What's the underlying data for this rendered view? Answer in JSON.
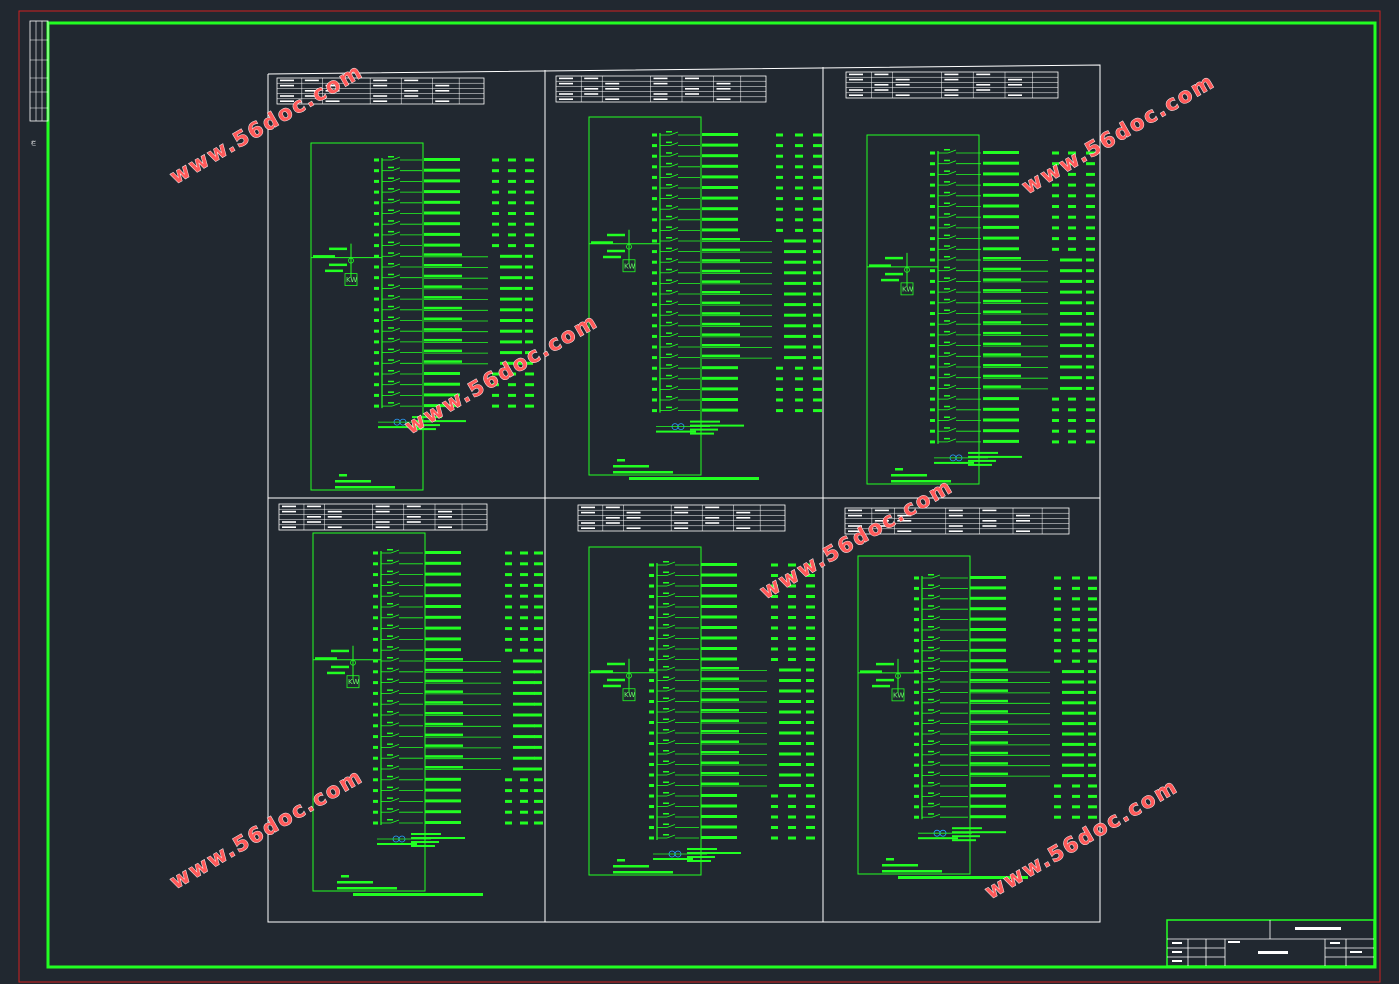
{
  "drawing": {
    "colors": {
      "background": "#212830",
      "outer_border": "#d02020",
      "inner_border": "#22ff22",
      "grid_lines": "#ffffff",
      "wire": "#22ff22",
      "watermark": "#ff5a5a",
      "dim_text": "#6cff6c"
    },
    "side_label": "栏",
    "watermark_text": "www.56doc.com",
    "meter_label": "KW",
    "panels": [
      {
        "id": "p1",
        "circuits": 24
      },
      {
        "id": "p2",
        "circuits": 27
      },
      {
        "id": "p3",
        "circuits": 28
      },
      {
        "id": "p4",
        "circuits": 26
      },
      {
        "id": "p5",
        "circuits": 27
      },
      {
        "id": "p6",
        "circuits": 24
      }
    ]
  }
}
